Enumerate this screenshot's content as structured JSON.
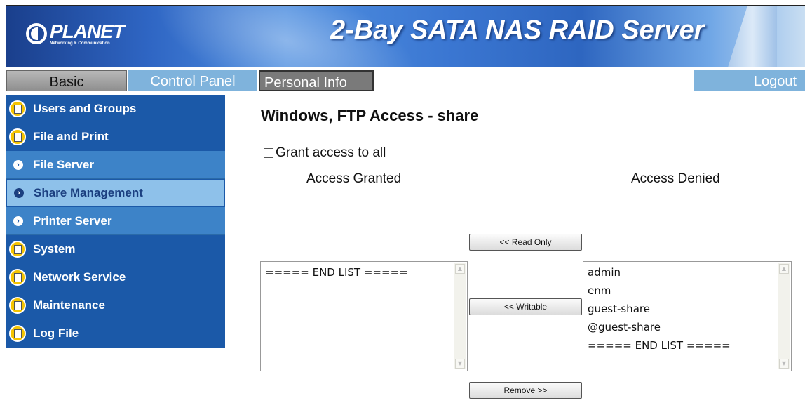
{
  "header": {
    "logo_name": "PLANET",
    "logo_tagline": "Networking & Communication",
    "product_title": "2-Bay SATA NAS RAID Server"
  },
  "nav": {
    "tabs": [
      {
        "label": "Basic"
      },
      {
        "label": "Control Panel"
      },
      {
        "label": "Personal Info"
      },
      {
        "label": "Logout"
      }
    ]
  },
  "sidebar": {
    "items": [
      {
        "label": "Users and Groups",
        "icon": "folder-icon"
      },
      {
        "label": "File and Print",
        "icon": "folder-icon"
      },
      {
        "label": "File Server",
        "icon": "chevron-right-icon"
      },
      {
        "label": "Share Management",
        "icon": "chevron-right-icon",
        "active": true
      },
      {
        "label": "Printer Server",
        "icon": "chevron-right-icon"
      },
      {
        "label": "System",
        "icon": "folder-icon"
      },
      {
        "label": "Network Service",
        "icon": "folder-icon"
      },
      {
        "label": "Maintenance",
        "icon": "folder-icon"
      },
      {
        "label": "Log File",
        "icon": "folder-icon"
      }
    ]
  },
  "main": {
    "title": "Windows, FTP Access - share",
    "grant_all_label": "Grant access to all",
    "grant_all_checked": false,
    "access_granted_label": "Access Granted",
    "access_denied_label": "Access Denied",
    "granted_list": [
      "===== END LIST ====="
    ],
    "denied_list": [
      "admin",
      "enm",
      "guest-share",
      "@guest-share",
      "===== END LIST ====="
    ],
    "buttons": {
      "read_only": "<< Read Only",
      "writable": "<< Writable",
      "remove": "Remove >>"
    }
  },
  "colors": {
    "sidebar_bg": "#1b59a8",
    "submenu_bg": "#3d83c8",
    "active_submenu_bg": "#8ec1ea",
    "tab_highlight": "#7fb3dc"
  }
}
